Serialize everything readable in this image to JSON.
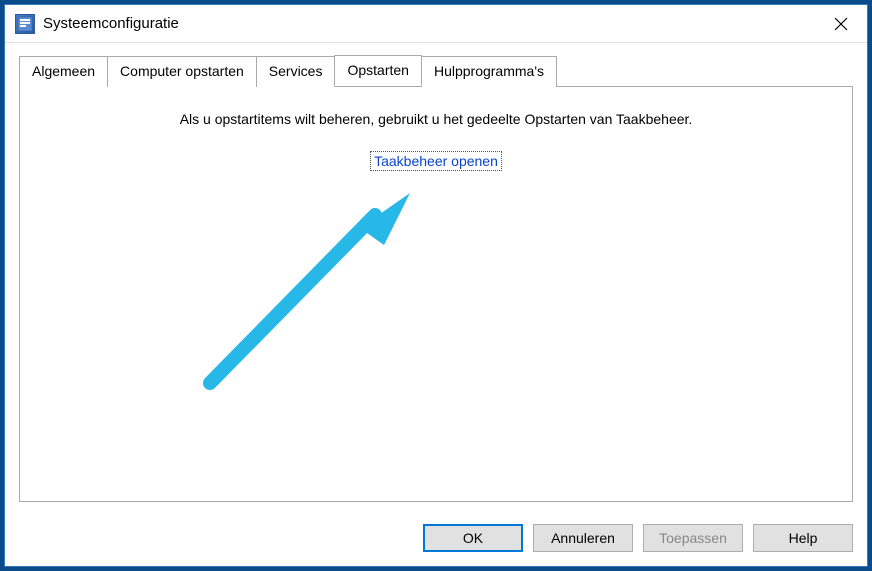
{
  "window": {
    "title": "Systeemconfiguratie"
  },
  "tabs": [
    {
      "label": "Algemeen",
      "active": false
    },
    {
      "label": "Computer opstarten",
      "active": false
    },
    {
      "label": "Services",
      "active": false
    },
    {
      "label": "Opstarten",
      "active": true
    },
    {
      "label": "Hulpprogramma's",
      "active": false
    }
  ],
  "panel": {
    "instruction": "Als u opstartitems wilt beheren, gebruikt u het gedeelte Opstarten van Taakbeheer.",
    "link_text": "Taakbeheer openen"
  },
  "buttons": {
    "ok": "OK",
    "cancel": "Annuleren",
    "apply": "Toepassen",
    "help": "Help"
  }
}
